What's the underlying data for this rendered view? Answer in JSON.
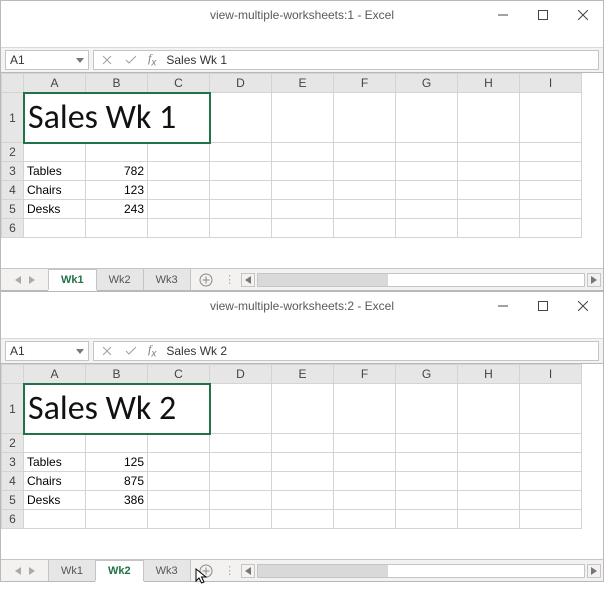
{
  "windows": [
    {
      "title": "view-multiple-worksheets:1 - Excel",
      "namebox": "A1",
      "formula": "Sales Wk 1",
      "cols": [
        "A",
        "B",
        "C",
        "D",
        "E",
        "F",
        "G",
        "H",
        "I"
      ],
      "rows": [
        "1",
        "2",
        "3",
        "4",
        "5",
        "6"
      ],
      "bigcell": "Sales Wk 1",
      "data": [
        {
          "label": "Tables",
          "val": "782"
        },
        {
          "label": "Chairs",
          "val": "123"
        },
        {
          "label": "Desks",
          "val": "243"
        }
      ],
      "tabs": [
        "Wk1",
        "Wk2",
        "Wk3"
      ],
      "activeTab": 0
    },
    {
      "title": "view-multiple-worksheets:2 - Excel",
      "namebox": "A1",
      "formula": "Sales Wk 2",
      "cols": [
        "A",
        "B",
        "C",
        "D",
        "E",
        "F",
        "G",
        "H",
        "I"
      ],
      "rows": [
        "1",
        "2",
        "3",
        "4",
        "5",
        "6"
      ],
      "bigcell": "Sales Wk 2",
      "data": [
        {
          "label": "Tables",
          "val": "125"
        },
        {
          "label": "Chairs",
          "val": "875"
        },
        {
          "label": "Desks",
          "val": "386"
        }
      ],
      "tabs": [
        "Wk1",
        "Wk2",
        "Wk3"
      ],
      "activeTab": 1
    }
  ]
}
